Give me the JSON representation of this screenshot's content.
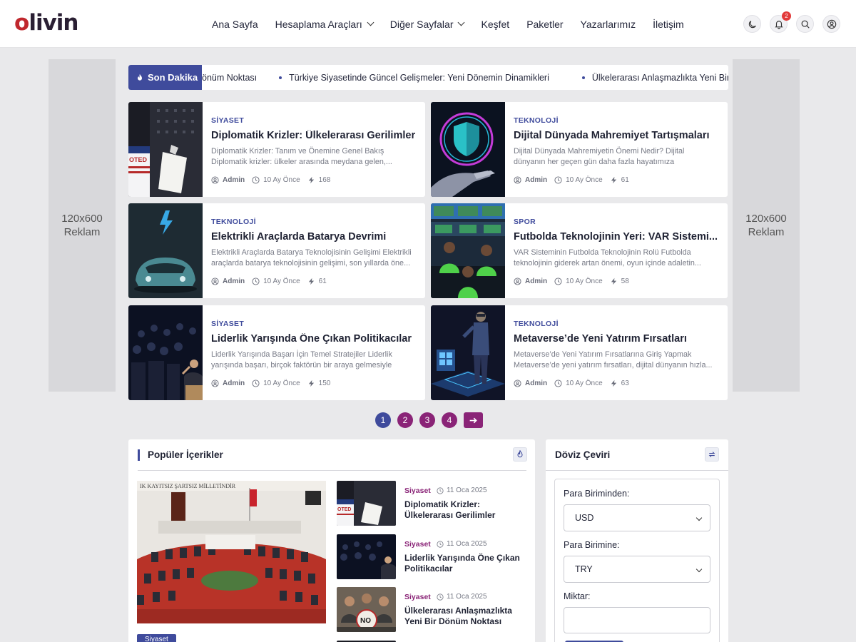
{
  "brand": {
    "name_o": "o",
    "name_rest": "livin"
  },
  "nav": [
    {
      "label": "Ana Sayfa",
      "dropdown": false
    },
    {
      "label": "Hesaplama Araçları",
      "dropdown": true
    },
    {
      "label": "Diğer Sayfalar",
      "dropdown": true
    },
    {
      "label": "Keşfet",
      "dropdown": false
    },
    {
      "label": "Paketler",
      "dropdown": false
    },
    {
      "label": "Yazarlarımız",
      "dropdown": false
    },
    {
      "label": "İletişim",
      "dropdown": false
    }
  ],
  "header_icons": {
    "notification_count": "2"
  },
  "ads": {
    "left": "120x600\nReklam",
    "right": "120x600\nReklam"
  },
  "ticker": {
    "label": "Son Dakika",
    "items": [
      "önüm Noktası",
      "Türkiye Siyasetinde Güncel Gelişmeler: Yeni Dönemin Dinamikleri",
      "Ülkelerarası Anlaşmazlıkta Yeni Bir Dönüm Noktası"
    ]
  },
  "articles": [
    {
      "category": "SİYASET",
      "title": "Diplomatik Krizler: Ülkelerarası Gerilimler",
      "excerpt": "Diplomatik Krizler: Tanım ve Önemine Genel Bakış Diplomatik krizler: ülkeler arasında meydana gelen,...",
      "author": "Admin",
      "time": "10 Ay Önce",
      "views": "168"
    },
    {
      "category": "TEKNOLOJİ",
      "title": "Dijital Dünyada Mahremiyet Tartışmaları",
      "excerpt": "Dijital Dünyada Mahremiyetin Önemi Nedir? Dijital dünyanın her geçen gün daha fazla hayatımıza girmesiyle,...",
      "author": "Admin",
      "time": "10 Ay Önce",
      "views": "61"
    },
    {
      "category": "TEKNOLOJİ",
      "title": "Elektrikli Araçlarda Batarya Devrimi",
      "excerpt": "Elektrikli Araçlarda Batarya Teknolojisinin Gelişimi Elektrikli araçlarda batarya teknolojisinin gelişimi, son yıllarda öne...",
      "author": "Admin",
      "time": "10 Ay Önce",
      "views": "61"
    },
    {
      "category": "SPOR",
      "title": "Futbolda Teknolojinin Yeri: VAR Sistemi...",
      "excerpt": "VAR Sisteminin Futbolda Teknolojinin Rolü Futbolda teknolojinin giderek artan önemi, oyun içinde adaletin...",
      "author": "Admin",
      "time": "10 Ay Önce",
      "views": "58"
    },
    {
      "category": "SİYASET",
      "title": "Liderlik Yarışında Öne Çıkan Politikacılar",
      "excerpt": "Liderlik Yarışında Başarı İçin Temel Stratejiler Liderlik yarışında başarı, birçok faktörün bir araya gelmesiyle elde...",
      "author": "Admin",
      "time": "10 Ay Önce",
      "views": "150"
    },
    {
      "category": "TEKNOLOJİ",
      "title": "Metaverse’de Yeni Yatırım Fırsatları",
      "excerpt": "Metaverse’de Yeni Yatırım Fırsatlarına Giriş Yapmak Metaverse’de yeni yatırım fırsatları, dijital dünyanın hızla...",
      "author": "Admin",
      "time": "10 Ay Önce",
      "views": "63"
    }
  ],
  "pagination": {
    "pages": [
      "1",
      "2",
      "3",
      "4"
    ],
    "current": "1",
    "next_icon": "arrow-right-icon"
  },
  "popular": {
    "title": "Popüler İçerikler",
    "featured_category": "Siyaset",
    "items": [
      {
        "category": "Siyaset",
        "date": "11 Oca 2025",
        "title": "Diplomatik Krizler: Ülkelerarası Gerilimler"
      },
      {
        "category": "Siyaset",
        "date": "11 Oca 2025",
        "title": "Liderlik Yarışında Öne Çıkan Politikacılar"
      },
      {
        "category": "Siyaset",
        "date": "11 Oca 2025",
        "title": "Ülkelerarası Anlaşmazlıkta Yeni Bir Dönüm Noktası"
      }
    ]
  },
  "currency": {
    "title": "Döviz Çeviri",
    "from_label": "Para Biriminden:",
    "from_value": "USD",
    "to_label": "Para Birimine:",
    "to_value": "TRY",
    "amount_label": "Miktar:",
    "amount_value": ""
  },
  "colors": {
    "primary": "#3f4b9c",
    "accent": "#8a2477",
    "brand_red": "#c0272d"
  }
}
